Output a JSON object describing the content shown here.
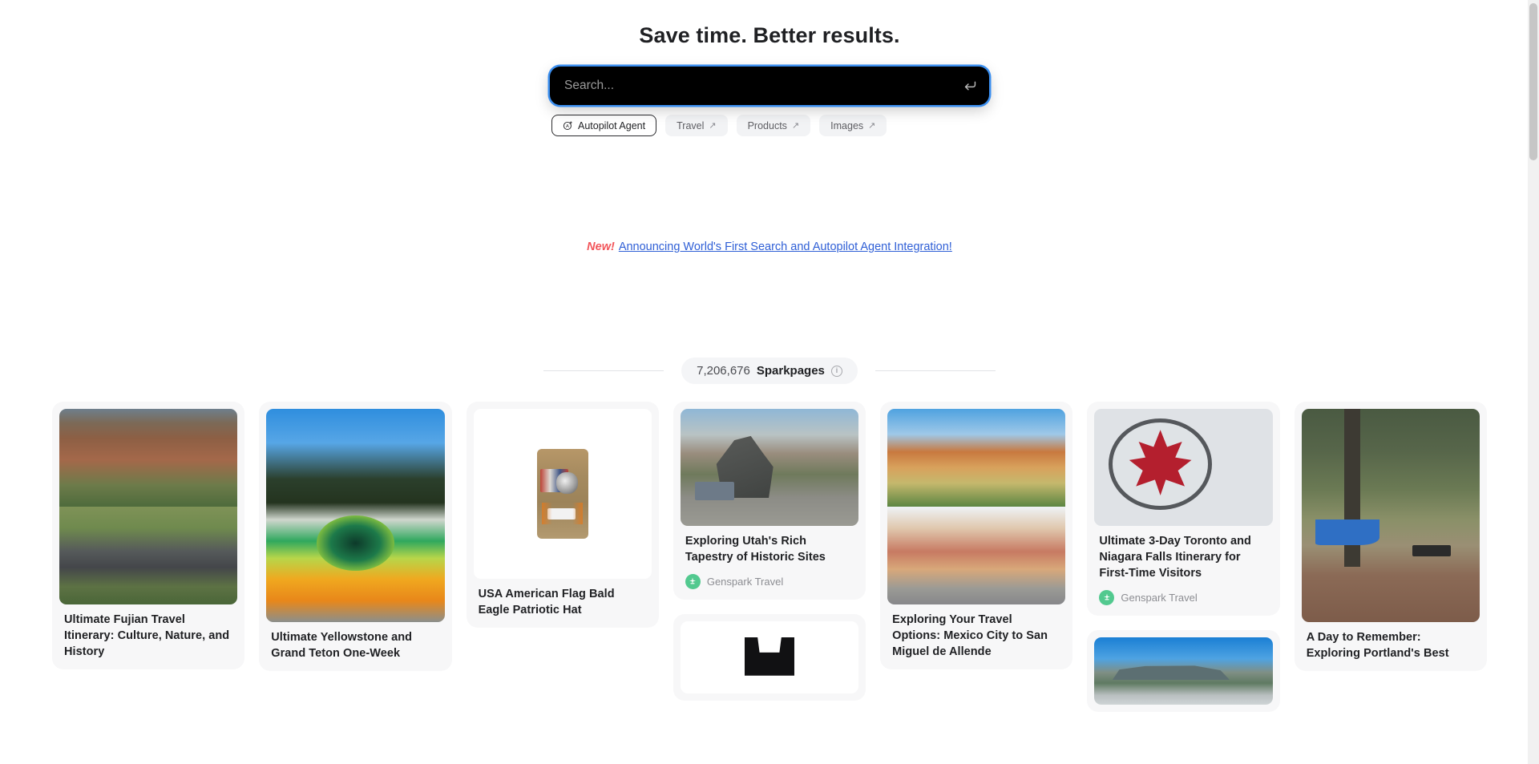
{
  "hero": {
    "title": "Save time. Better results."
  },
  "search": {
    "placeholder": "Search...",
    "value": "",
    "submit_icon": "enter-return-icon",
    "focus_ring_color": "#3b8ff0",
    "background": "#000000"
  },
  "chips": [
    {
      "label": "Autopilot Agent",
      "icon": "autopilot-agent-icon",
      "arrow": "",
      "active": true
    },
    {
      "label": "Travel",
      "icon": "",
      "arrow": "↗",
      "active": false
    },
    {
      "label": "Products",
      "icon": "",
      "arrow": "↗",
      "active": false
    },
    {
      "label": "Images",
      "icon": "",
      "arrow": "↗",
      "active": false
    }
  ],
  "announcement": {
    "tag": "New!",
    "link_text": "Announcing World's First Search and Autopilot Agent Integration!",
    "tag_color": "#f2555a",
    "link_color": "#2f5fd6"
  },
  "sparkpages": {
    "count": "7,206,676",
    "label": "Sparkpages",
    "info_icon": "info-icon"
  },
  "grid": {
    "columns": [
      {
        "cards": [
          {
            "type": "article",
            "title": "Ultimate Fujian Travel Itinerary: Culture, Nature, and History",
            "media": "split-town-tulou",
            "source": null
          }
        ]
      },
      {
        "cards": [
          {
            "type": "article",
            "title": "Ultimate Yellowstone and Grand Teton One-Week",
            "media": "yellowstone-morning-glory-pool",
            "source": null
          }
        ]
      },
      {
        "cards": [
          {
            "type": "product",
            "title": "USA American Flag Bald Eagle Patriotic Hat",
            "media": "camo-eagle-cap",
            "source": null
          }
        ]
      },
      {
        "cards": [
          {
            "type": "article",
            "title": "Exploring Utah's Rich Tapestry of Historic Sites",
            "media": "utah-equestrian-monument",
            "source": {
              "name": "Genspark Travel",
              "logo": "genspark-logo-icon",
              "color": "#52c98f"
            }
          },
          {
            "type": "product",
            "title": "",
            "media": "black-garment",
            "source": null
          }
        ]
      },
      {
        "cards": [
          {
            "type": "article",
            "title": "Exploring Your Travel Options: Mexico City to San Miguel de Allende",
            "media": "split-sanmiguel-church-street",
            "source": null
          }
        ]
      },
      {
        "cards": [
          {
            "type": "article",
            "title": "Ultimate 3-Day Toronto and Niagara Falls Itinerary for First-Time Visitors",
            "media": "tim-hortons-sign-toronto",
            "source": {
              "name": "Genspark Travel",
              "logo": "genspark-logo-icon",
              "color": "#52c98f"
            }
          },
          {
            "type": "article",
            "title": "",
            "media": "cape-town-table-mountain",
            "source": null
          }
        ]
      },
      {
        "cards": [
          {
            "type": "article",
            "title": "A Day to Remember: Exploring Portland's Best",
            "media": "portland-playground-park",
            "source": null
          }
        ]
      }
    ]
  },
  "scrollbar": {
    "position": "top"
  }
}
